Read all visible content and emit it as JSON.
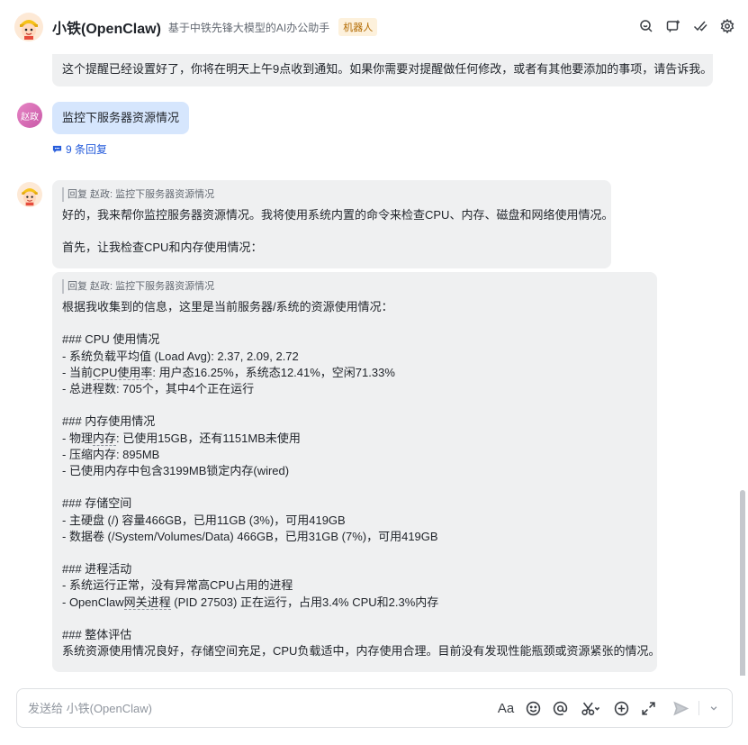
{
  "header": {
    "title": "小铁(OpenClaw)",
    "subtitle": "基于中铁先锋大模型的AI办公助手",
    "badge": "机器人",
    "actions": [
      "search-chat-icon",
      "add-chat-icon",
      "task-check-icon",
      "settings-gear-icon"
    ]
  },
  "messages": {
    "top_bubble": "这个提醒已经设置好了，你将在明天上午9点收到通知。如果你需要对提醒做任何修改，或者有其他要添加的事项，请告诉我。",
    "user": {
      "avatar_text": "赵政",
      "text": "监控下服务器资源情况",
      "replies": "9 条回复"
    },
    "bot_reply_1": {
      "quote": "回复 赵政: 监控下服务器资源情况",
      "line1": "好的，我来帮你监控服务器资源情况。我将使用系统内置的命令来检查CPU、内存、磁盘和网络使用情况。",
      "line2": "首先，让我检查CPU和内存使用情况："
    },
    "bot_reply_2": {
      "quote": "回复 赵政: 监控下服务器资源情况",
      "intro": "根据我收集到的信息，这里是当前服务器/系统的资源使用情况：",
      "cpu_heading": "### CPU 使用情况",
      "cpu_1": "- 系统负载平均值 (Load Avg): 2.37, 2.09, 2.72",
      "cpu_2_prefix": "- 当前",
      "cpu_2_dotted": "CPU使用率",
      "cpu_2_suffix": ": 用户态16.25%，系统态12.41%，空闲71.33%",
      "cpu_3": "- 总进程数: 705个，其中4个正在运行",
      "mem_heading": "### 内存使用情况",
      "mem_1_prefix": "- 物理",
      "mem_1_dotted": "内存",
      "mem_1_suffix": ": 已使用15GB，还有1151MB未使用",
      "mem_2": "- 压缩内存: 895MB",
      "mem_3": "- 已使用内存中包含3199MB锁定内存(wired)",
      "storage_heading": "### 存储空间",
      "storage_1": "- 主硬盘 (/) 容量466GB，已用11GB (3%)，可用419GB",
      "storage_2": "- 数据卷 (/System/Volumes/Data) 466GB，已用31GB (7%)，可用419GB",
      "proc_heading": "### 进程活动",
      "proc_1": "- 系统运行正常，没有异常高CPU占用的进程",
      "proc_2_prefix": "- OpenClaw",
      "proc_2_dotted": "网关进程",
      "proc_2_suffix": " (PID 27503) 正在运行，占用3.4% CPU和2.3%内存",
      "eval_heading": "### 整体评估",
      "eval_1": "系统资源使用情况良好，存储空间充足，CPU负载适中，内存使用合理。目前没有发现性能瓶颈或资源紧张的情况。"
    }
  },
  "input": {
    "placeholder": "发送给 小铁(OpenClaw)",
    "value": "",
    "format_label": "Aa"
  }
}
